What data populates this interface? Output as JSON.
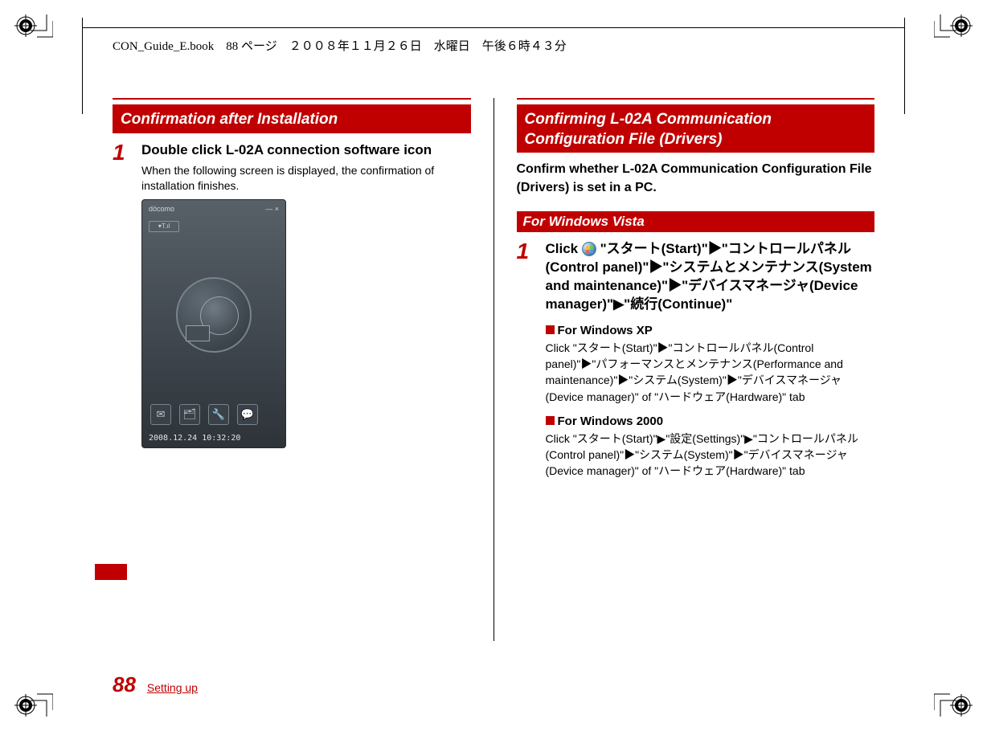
{
  "header": {
    "filepath": "CON_Guide_E.book　88 ページ　２００８年１１月２６日　水曜日　午後６時４３分"
  },
  "leftColumn": {
    "sectionTitle": "Confirmation after Installation",
    "step1": {
      "num": "1",
      "title": "Double click L-02A connection software icon",
      "desc": "When the following screen is displayed, the confirmation of installation finishes."
    },
    "screenshot": {
      "brand": "döcomo",
      "winButtons": "— ×",
      "signal": "▾T.ıl",
      "icons": [
        "✉",
        "🗂",
        "🔧",
        "💬"
      ],
      "timestamp": "2008.12.24 10:32:20"
    }
  },
  "rightColumn": {
    "sectionTitle": "Confirming L-02A Communication Configuration File (Drivers)",
    "intro": "Confirm whether L-02A Communication Configuration File (Drivers) is set in a PC.",
    "subBar": "For Windows Vista",
    "step1": {
      "num": "1",
      "title": "Click 🔘 \"スタート(Start)\"▶\"コントロールパネル(Control panel)\"▶\"システムとメンテナンス(System and maintenance)\"▶\"デバイスマネージャ(Device manager)\"▶\"続行(Continue)\""
    },
    "xp": {
      "title": "For Windows XP",
      "body": "Click \"スタート(Start)\"▶\"コントロールパネル(Control panel)\"▶\"パフォーマンスとメンテナンス(Performance and maintenance)\"▶\"システム(System)\"▶\"デバイスマネージャ(Device manager)\" of \"ハードウェア(Hardware)\" tab"
    },
    "w2000": {
      "title": "For Windows 2000",
      "body": " Click \"スタート(Start)\"▶\"設定(Settings)\"▶\"コントロールパネル(Control panel)\"▶\"システム(System)\"▶\"デバイスマネージャ(Device manager)\" of \"ハードウェア(Hardware)\" tab"
    }
  },
  "footer": {
    "pageNum": "88",
    "section": "Setting up"
  }
}
